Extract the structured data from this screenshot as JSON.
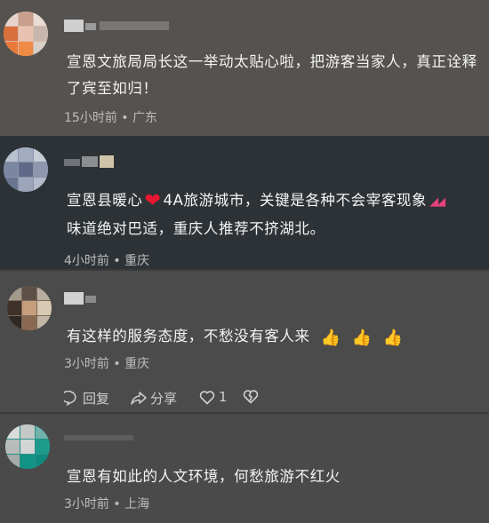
{
  "comments": [
    {
      "text": "宣恩文旅局局长这一举动太贴心啦，把游客当家人，真正诠释了宾至如归！",
      "time": "15小时前",
      "location": "广东",
      "dot": "•"
    },
    {
      "text_before": "宣恩县暖心",
      "text_after": "4A旅游城市，关键是各种不会宰客现象",
      "text_line2": "味道绝对巴适，重庆人推荐不挤湖北。",
      "time": "4小时前",
      "location": "重庆",
      "dot": "•",
      "heart_emoji": "heart-icon",
      "fire_emoji": "fire-icon"
    },
    {
      "text": "有这样的服务态度，不愁没有客人来",
      "thumbs": [
        "👍",
        "👍",
        "👍"
      ],
      "time": "3小时前",
      "location": "重庆",
      "dot": "•",
      "actions": {
        "reply": "回复",
        "share": "分享",
        "like_count": "1"
      }
    },
    {
      "text": "宣恩有如此的人文环境，何愁旅游不红火",
      "time": "3小时前",
      "location": "上海",
      "dot": "•"
    }
  ],
  "colors": {
    "heart": "#e6172e",
    "text": "#f4f4f4",
    "meta": "#bdbdbd"
  }
}
